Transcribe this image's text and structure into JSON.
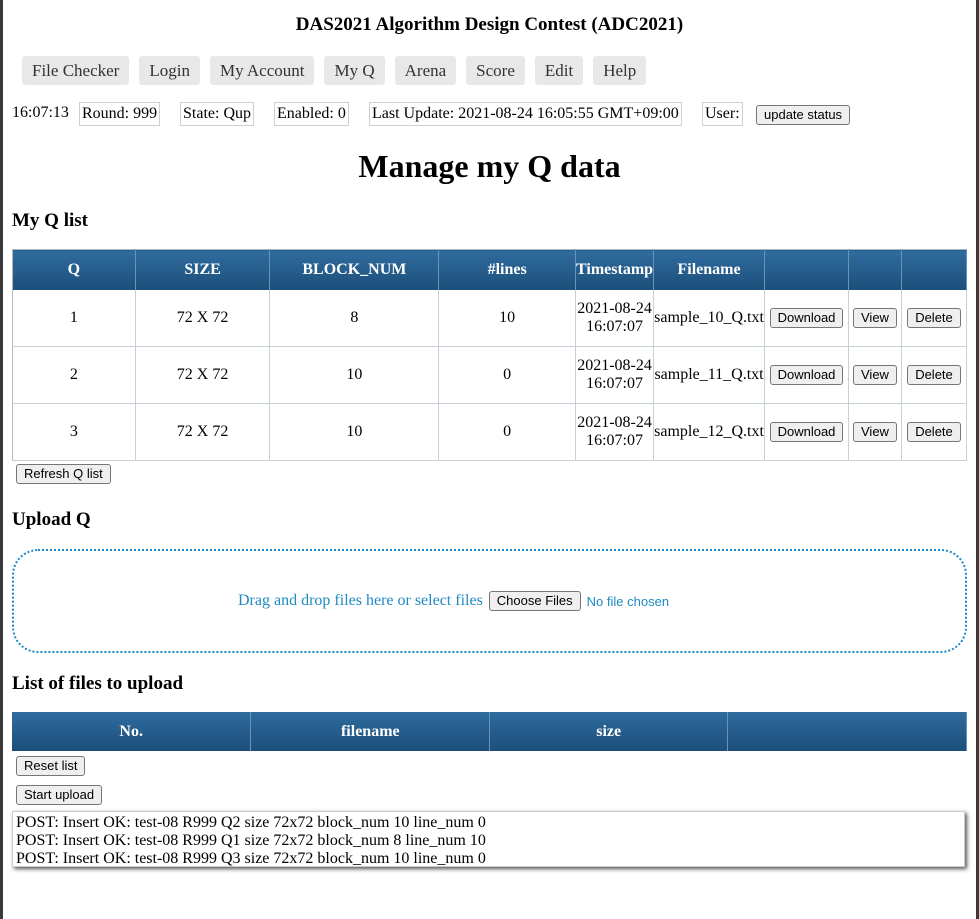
{
  "header": {
    "title": "DAS2021 Algorithm Design Contest (ADC2021)"
  },
  "nav": {
    "items": [
      "File Checker",
      "Login",
      "My Account",
      "My Q",
      "Arena",
      "Score",
      "Edit",
      "Help"
    ]
  },
  "status": {
    "time": "16:07:13",
    "round": "Round: 999",
    "state": "State: Qup",
    "enabled": "Enabled: 0",
    "last_update": "Last Update: 2021-08-24 16:05:55 GMT+09:00",
    "user": "User:",
    "update_button": "update status"
  },
  "page": {
    "heading": "Manage my Q data"
  },
  "q_list": {
    "heading": "My Q list",
    "columns": [
      "Q",
      "SIZE",
      "BLOCK_NUM",
      "#lines",
      "Timestamp",
      "Filename",
      "",
      "",
      ""
    ],
    "rows": [
      {
        "q": "1",
        "size": "72 X 72",
        "block_num": "8",
        "lines": "10",
        "date": "2021-08-24",
        "time": "16:07:07",
        "filename": "sample_10_Q.txt"
      },
      {
        "q": "2",
        "size": "72 X 72",
        "block_num": "10",
        "lines": "0",
        "date": "2021-08-24",
        "time": "16:07:07",
        "filename": "sample_11_Q.txt"
      },
      {
        "q": "3",
        "size": "72 X 72",
        "block_num": "10",
        "lines": "0",
        "date": "2021-08-24",
        "time": "16:07:07",
        "filename": "sample_12_Q.txt"
      }
    ],
    "download_label": "Download",
    "view_label": "View",
    "delete_label": "Delete",
    "refresh_label": "Refresh Q list"
  },
  "upload": {
    "heading": "Upload Q",
    "drop_text": "Drag and drop files here or select files",
    "choose_label": "Choose Files",
    "no_file": "No file chosen"
  },
  "file_list": {
    "heading": "List of files to upload",
    "columns": [
      "No.",
      "filename",
      "size",
      ""
    ],
    "reset_label": "Reset list",
    "start_label": "Start upload"
  },
  "log": {
    "lines": [
      "POST: Insert OK: test-08 R999 Q2 size 72x72 block_num 10 line_num 0",
      "POST: Insert OK: test-08 R999 Q1 size 72x72 block_num 8 line_num 10",
      "POST: Insert OK: test-08 R999 Q3 size 72x72 block_num 10 line_num 0"
    ]
  }
}
